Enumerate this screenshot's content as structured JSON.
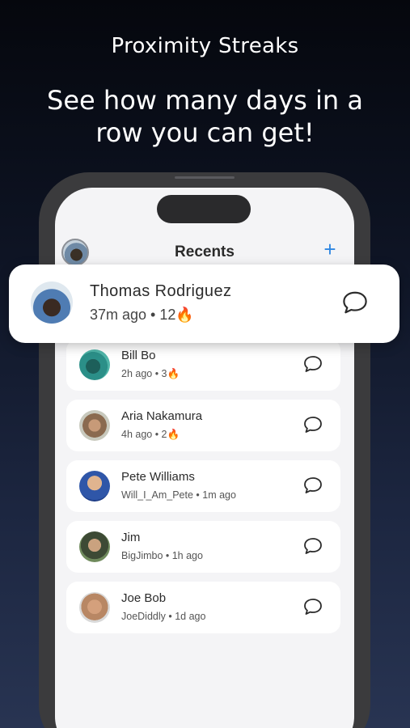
{
  "promo": {
    "subtitle": "Proximity Streaks",
    "headline_line1": "See how many days in a",
    "headline_line2": "row you can get!"
  },
  "nav": {
    "title": "Recents",
    "add_symbol": "+"
  },
  "highlighted_contact": {
    "name": "Thomas Rodriguez",
    "detail": "37m ago • 12🔥"
  },
  "contacts": [
    {
      "name": "Bill Bo",
      "detail": "2h ago • 3🔥"
    },
    {
      "name": "Aria Nakamura",
      "detail": "4h ago • 2🔥"
    },
    {
      "name": "Pete Williams",
      "detail": "Will_I_Am_Pete • 1m ago"
    },
    {
      "name": "Jim",
      "detail": "BigJimbo • 1h ago"
    },
    {
      "name": "Joe Bob",
      "detail": "JoeDiddly • 1d ago"
    }
  ],
  "colors": {
    "accent": "#2f87e2",
    "screen_bg": "#f4f4f6",
    "card_bg": "#ffffff"
  }
}
